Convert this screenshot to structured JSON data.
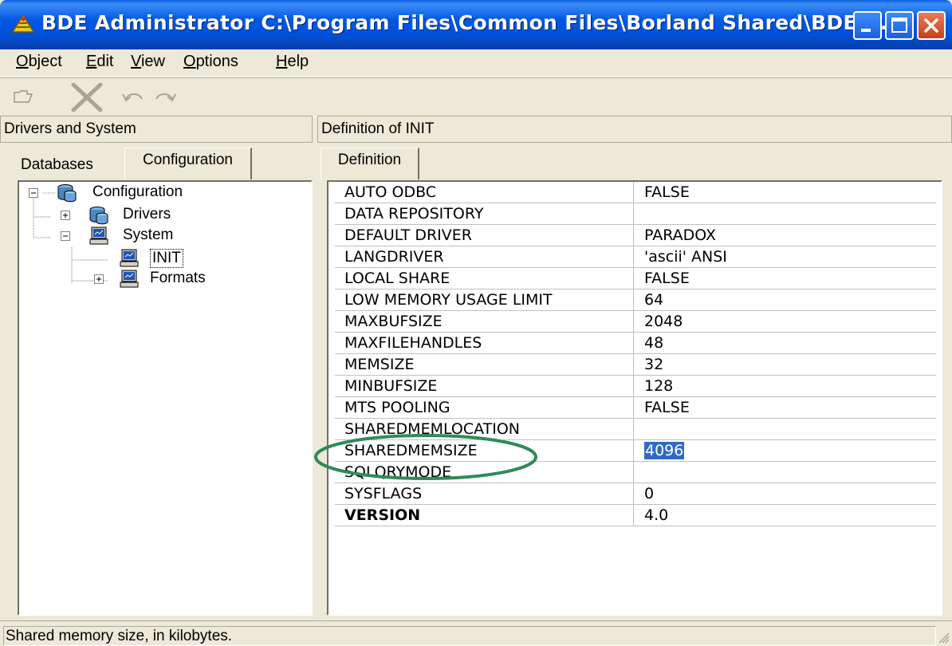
{
  "window": {
    "title": "BDE Administrator  C:\\Program Files\\Common Files\\Borland Shared\\BDE\\..."
  },
  "menu": [
    "Object",
    "Edit",
    "View",
    "Options",
    "Help"
  ],
  "left_panel": {
    "header": "Drivers and System",
    "tabs": [
      "Databases",
      "Configuration"
    ],
    "active_tab": "Configuration",
    "tree": [
      {
        "label": "Configuration",
        "expander": "minus",
        "icon": "database-icon"
      },
      {
        "label": "Drivers",
        "expander": "plus",
        "icon": "database-icon"
      },
      {
        "label": "System",
        "expander": "minus",
        "icon": "computer-icon"
      },
      {
        "label": "INIT",
        "expander": "",
        "icon": "computer-icon"
      },
      {
        "label": "Formats",
        "expander": "plus",
        "icon": "computer-icon"
      }
    ]
  },
  "right_panel": {
    "header": "Definition of INIT",
    "tab": "Definition",
    "rows": [
      {
        "name": "AUTO ODBC",
        "value": "FALSE"
      },
      {
        "name": "DATA REPOSITORY",
        "value": ""
      },
      {
        "name": "DEFAULT DRIVER",
        "value": "PARADOX"
      },
      {
        "name": "LANGDRIVER",
        "value": "'ascii' ANSI"
      },
      {
        "name": "LOCAL SHARE",
        "value": "FALSE"
      },
      {
        "name": "LOW MEMORY USAGE LIMIT",
        "value": "64"
      },
      {
        "name": "MAXBUFSIZE",
        "value": "2048"
      },
      {
        "name": "MAXFILEHANDLES",
        "value": "48"
      },
      {
        "name": "MEMSIZE",
        "value": "32"
      },
      {
        "name": "MINBUFSIZE",
        "value": "128"
      },
      {
        "name": "MTS POOLING",
        "value": "FALSE"
      },
      {
        "name": "SHAREDMEMLOCATION",
        "value": ""
      },
      {
        "name": "SHAREDMEMSIZE",
        "value": "4096"
      },
      {
        "name": "SQLQRYMODE",
        "value": ""
      },
      {
        "name": "SYSFLAGS",
        "value": "0"
      },
      {
        "name": "VERSION",
        "value": "4.0"
      }
    ]
  },
  "status": "Shared memory size, in kilobytes.",
  "colors": {
    "title_bar": "#0058e6",
    "highlight": "#316ac5",
    "annotation_oval": "#2e8b57"
  }
}
